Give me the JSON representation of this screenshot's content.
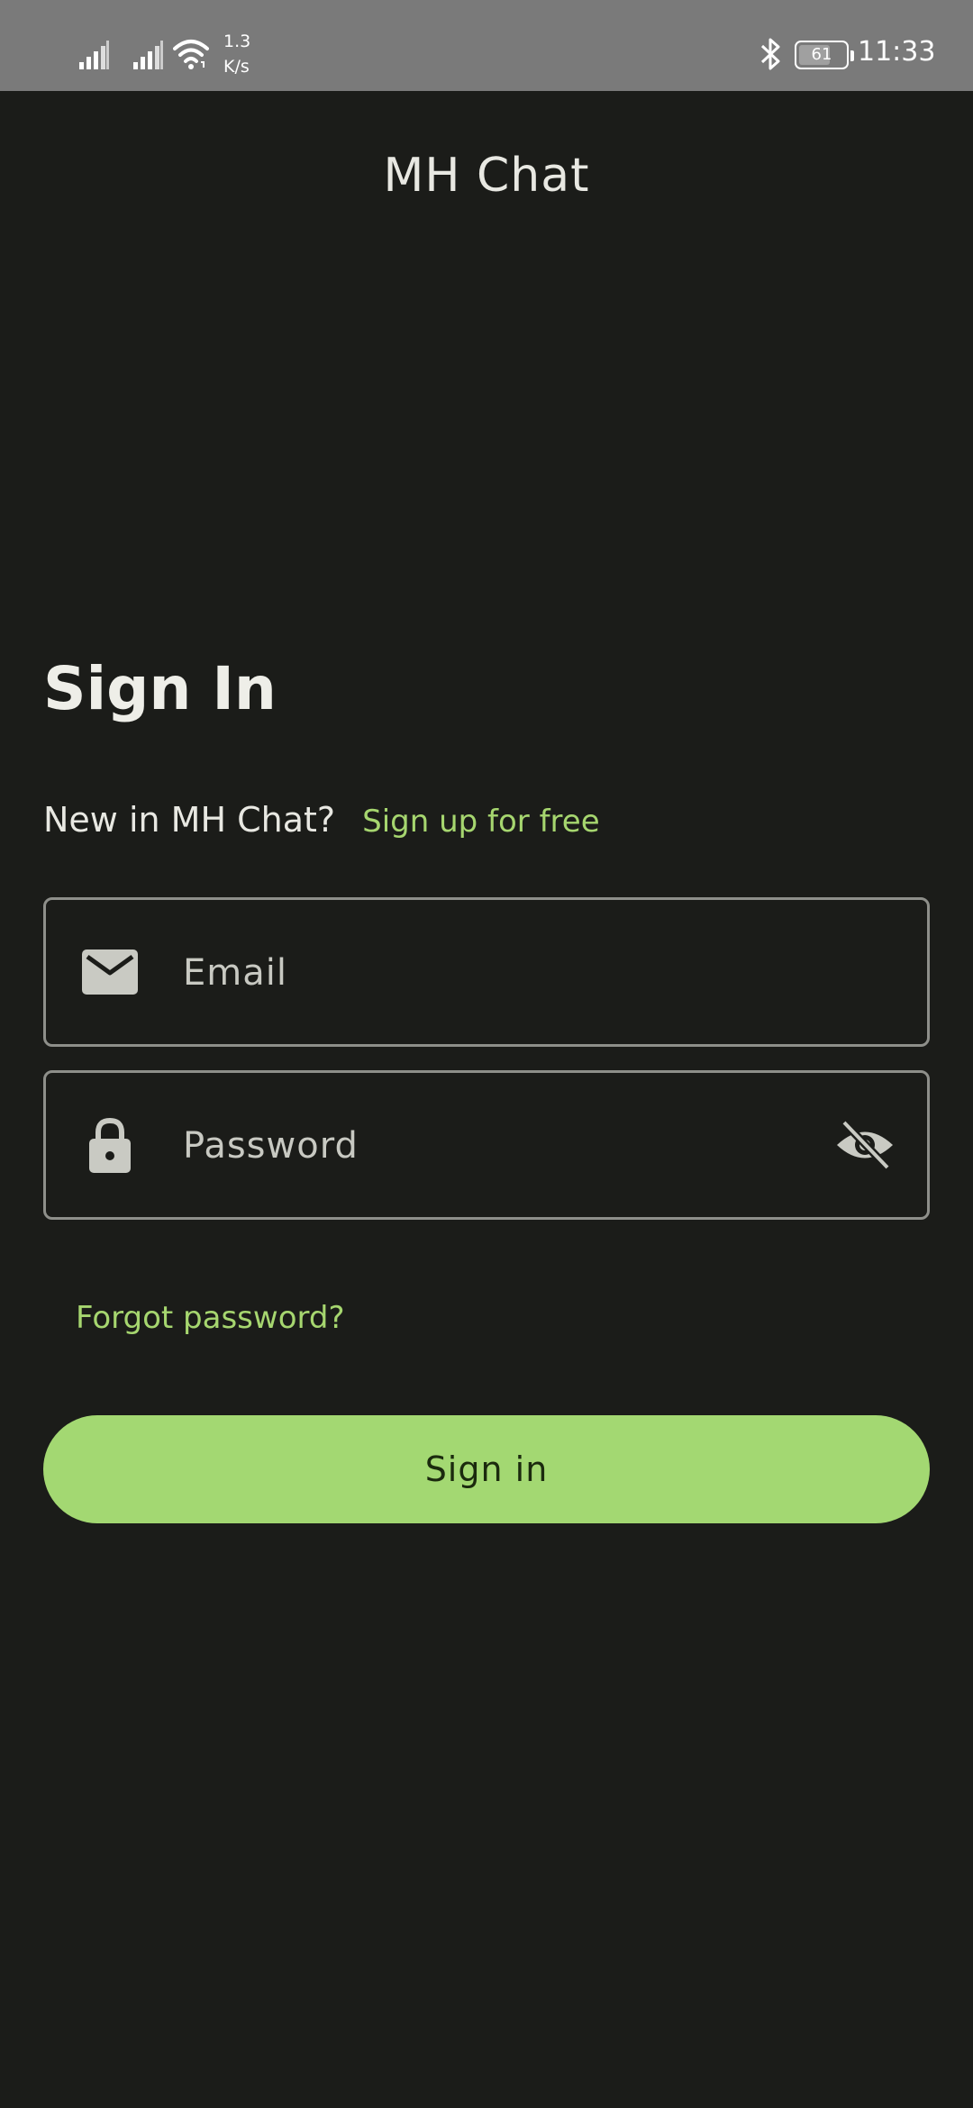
{
  "status_bar": {
    "net_speed_value": "1.3",
    "net_speed_unit": "K/s",
    "battery_level": "61",
    "time": "11:33",
    "icons": [
      "signal-icon",
      "signal-icon",
      "wifi-icon",
      "bluetooth-icon",
      "battery-icon"
    ]
  },
  "app": {
    "title": "MH Chat"
  },
  "signin": {
    "heading": "Sign In",
    "new_prompt": "New in MH Chat?",
    "signup_link": "Sign up for free",
    "email_placeholder": "Email",
    "password_placeholder": "Password",
    "forgot_link": "Forgot password?",
    "submit_label": "Sign in"
  },
  "colors": {
    "background": "#1b1c19",
    "accent": "#a3d872",
    "link": "#a6d66f",
    "field_border": "#8e8f8a",
    "status_bar": "#7a7a7a"
  },
  "field_icons": {
    "email": "mail-icon",
    "password": "lock-icon",
    "visibility": "eye-off-icon"
  }
}
